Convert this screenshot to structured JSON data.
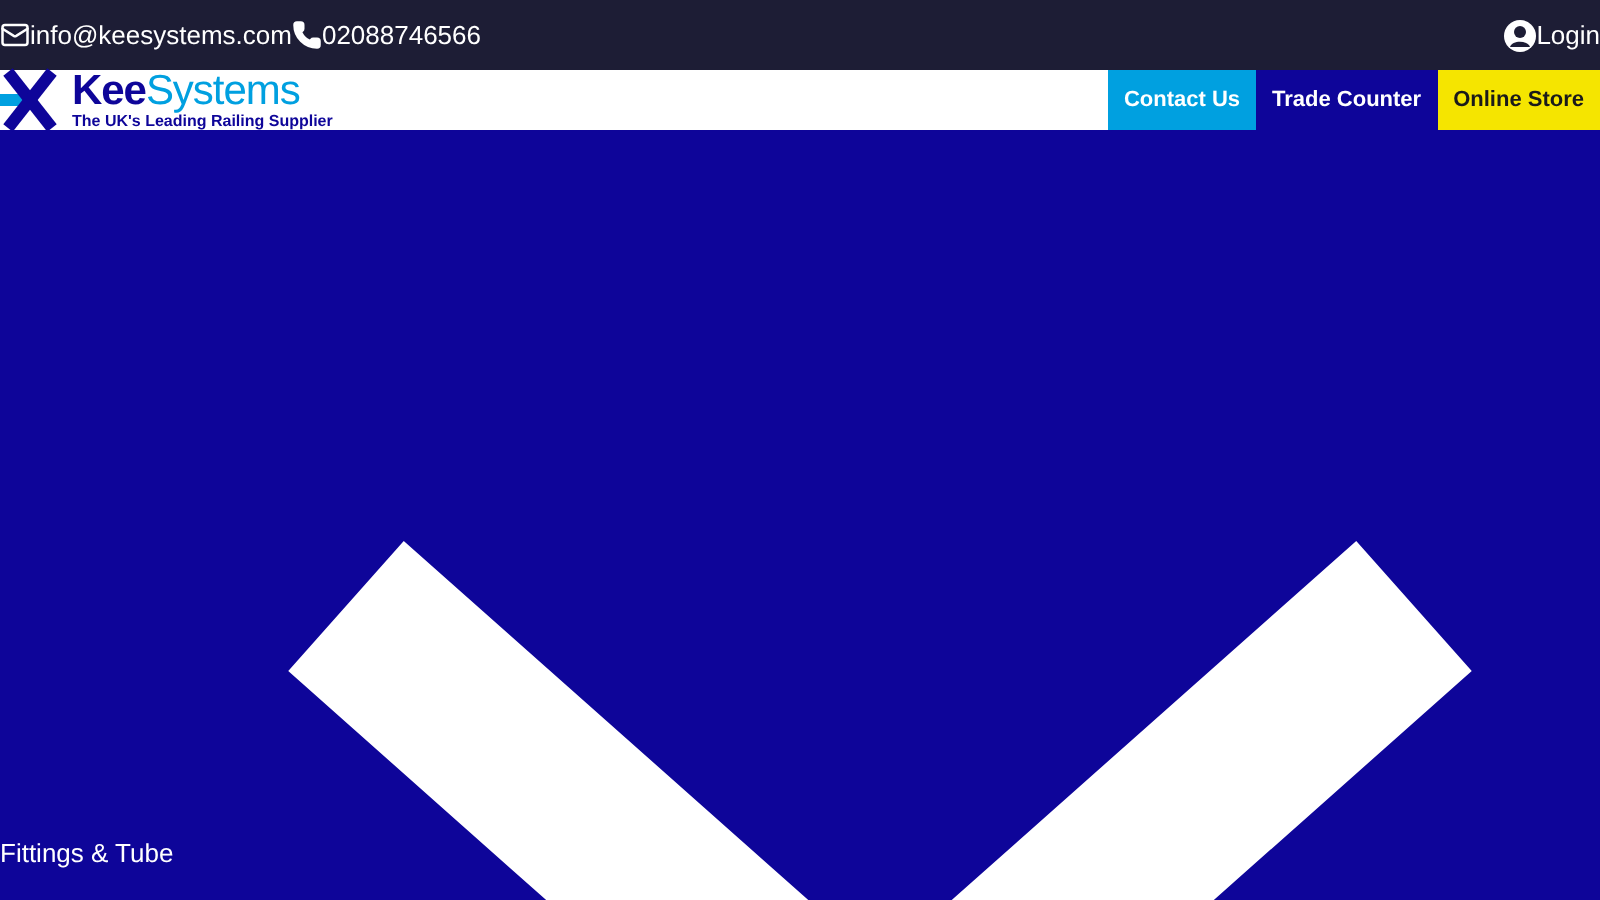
{
  "top_bar": {
    "email": "info@keesystems.com",
    "phone": "02088746566",
    "login": "Login"
  },
  "logo": {
    "name_part_1": "Kee",
    "name_part_2": "Systems",
    "tagline": "The UK's Leading Railing Supplier"
  },
  "nav_buttons": [
    {
      "label": "Contact Us",
      "kind": "contact"
    },
    {
      "label": "Trade Counter",
      "kind": "trade"
    },
    {
      "label": "Online Store",
      "kind": "store"
    }
  ],
  "hero": {
    "caption": "Fittings & Tube"
  }
}
